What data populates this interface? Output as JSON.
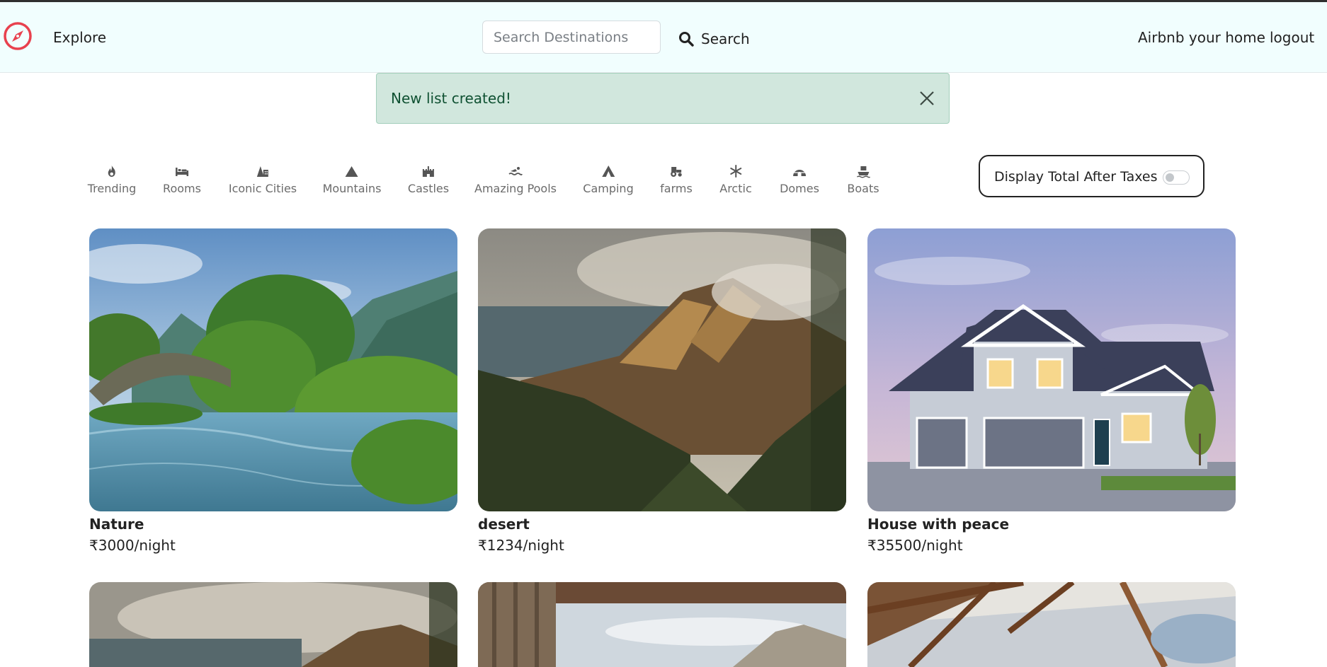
{
  "navbar": {
    "explore_label": "Explore",
    "search_placeholder": "Search Destinations",
    "search_label": "Search",
    "host_label": "Airbnb your home",
    "logout_label": "logout",
    "brand_color": "#e8414e"
  },
  "alert": {
    "message": "New list created!"
  },
  "filters": [
    {
      "label": "Trending",
      "icon": "fire-icon"
    },
    {
      "label": "Rooms",
      "icon": "bed-icon"
    },
    {
      "label": "Iconic Cities",
      "icon": "city-icon"
    },
    {
      "label": "Mountains",
      "icon": "mountain-icon"
    },
    {
      "label": "Castles",
      "icon": "castle-icon"
    },
    {
      "label": "Amazing Pools",
      "icon": "pool-icon"
    },
    {
      "label": "Camping",
      "icon": "tent-icon"
    },
    {
      "label": "farms",
      "icon": "tractor-icon"
    },
    {
      "label": "Arctic",
      "icon": "snowflake-icon"
    },
    {
      "label": "Domes",
      "icon": "igloo-icon"
    },
    {
      "label": "Boats",
      "icon": "ship-icon"
    }
  ],
  "tax_toggle": {
    "label": "Display Total After Taxes",
    "checked": false
  },
  "listings": [
    {
      "title": "Nature",
      "price": "₹3000/night"
    },
    {
      "title": "desert",
      "price": "₹1234/night"
    },
    {
      "title": "House with peace",
      "price": "₹35500/night"
    }
  ]
}
